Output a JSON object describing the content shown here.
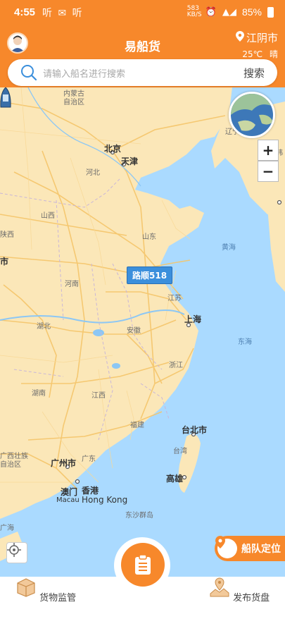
{
  "status": {
    "time": "4:55",
    "icons": "听 ✉ 听",
    "net_speed": "583 KB/S",
    "battery": "85%"
  },
  "header": {
    "title": "易船货",
    "city": "江阴市",
    "temperature": "25℃",
    "weather": "晴"
  },
  "search": {
    "placeholder": "请输入船名进行搜索",
    "button": "搜索"
  },
  "map": {
    "zoom_in": "+",
    "zoom_out": "−",
    "ship_name": "路顺518",
    "labels": {
      "inner_mongolia": "内蒙古",
      "inner_mongolia2": "自治区",
      "liaoning": "辽宁",
      "beijing": "北京",
      "tianjin": "天津",
      "hebei": "河北",
      "shanxi": "山西",
      "shandong": "山东",
      "shaanxi": "陕西",
      "city_left": "市",
      "henan": "河南",
      "jiangsu": "江苏",
      "anhui": "安徽",
      "shanghai": "上海",
      "hubei": "湖北",
      "zhejiang": "浙江",
      "hunan": "湖南",
      "jiangxi": "江西",
      "fujian": "福建",
      "guangxi1": "广西壮族",
      "guangxi2": "自治区",
      "guangdong": "广东",
      "guangzhou": "广州市",
      "macau": "澳门",
      "macau_en": "Macau",
      "hongkong": "香港",
      "hongkong_en": "Hong Kong",
      "dongsha": "东沙群岛",
      "taipei": "台北市",
      "taiwan": "台湾",
      "kaohsiung": "高雄",
      "yellow_sea": "黄海",
      "east_sea": "东海",
      "guanghai": "广海",
      "korea": "韩"
    }
  },
  "fleet_button": "船队定位",
  "nav": {
    "left": "货物监管",
    "right": "发布货盘"
  },
  "colors": {
    "brand": "#f7882b",
    "ship_label": "#3b8fdc",
    "sea": "#aadaff",
    "land": "#fbe7b8"
  }
}
